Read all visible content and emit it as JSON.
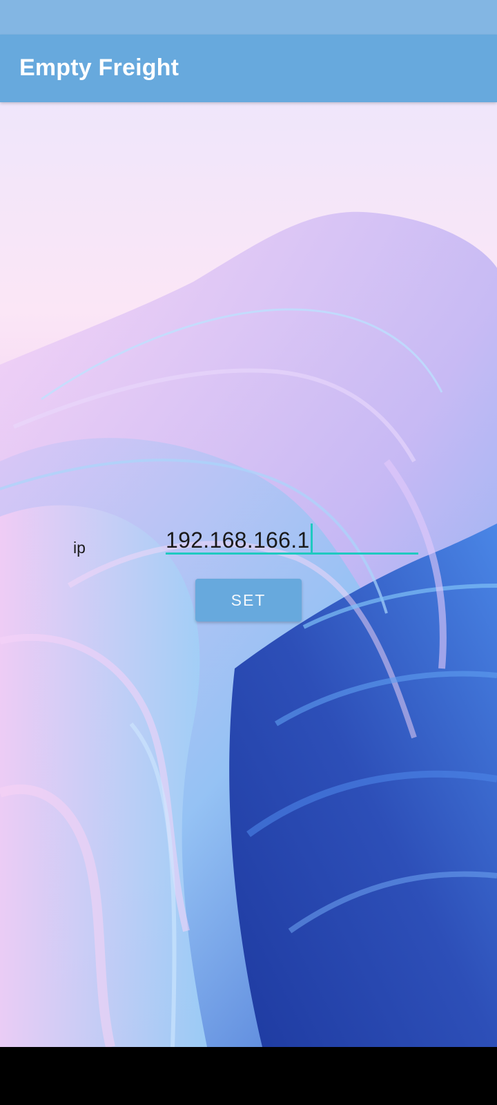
{
  "app_bar": {
    "title": "Empty Freight"
  },
  "form": {
    "ip_label": "ip",
    "ip_value": "192.168.166.1",
    "set_button_label": "SET"
  },
  "colors": {
    "app_bar": "#67a9dd",
    "status_bar": "#83b6e3",
    "input_accent": "#1fc9c0",
    "button": "#67a9dd"
  },
  "background": {
    "wallpaper": "abstract-wave-wallpaper"
  }
}
